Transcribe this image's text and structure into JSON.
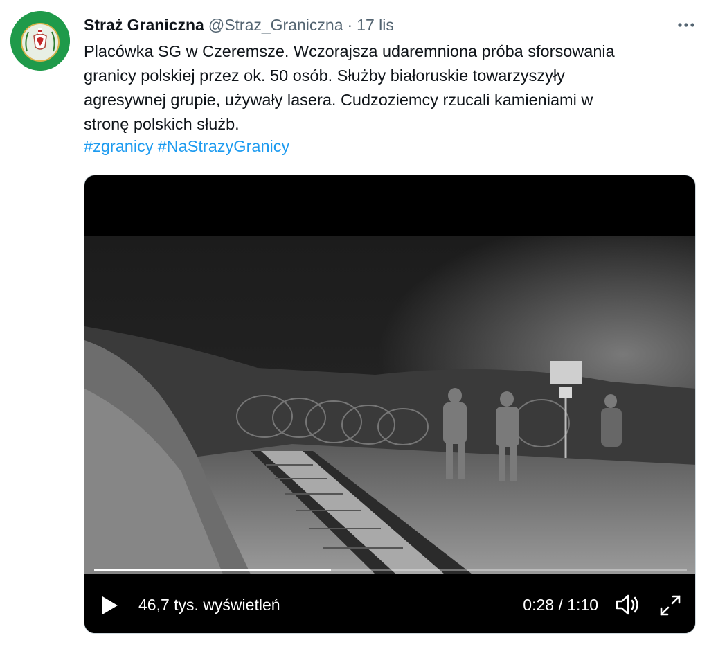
{
  "tweet": {
    "author_name": "Straż Graniczna",
    "handle": "@Straz_Graniczna",
    "separator": "·",
    "date": "17 lis",
    "text": "Placówka SG w Czeremsze. Wczorajsza udaremniona próba sforsowania\ngranicy polskiej przez ok. 50 osób. Służby białoruskie towarzyszyły\nagresywnej grupie, używały lasera. Cudzoziemcy rzucali kamieniami w\nstronę polskich służb.",
    "hashtags": [
      "#zgranicy",
      "#NaStrazyGranicy"
    ]
  },
  "video": {
    "views": "46,7 tys. wyświetleń",
    "time": "0:28 / 1:10",
    "progress_fraction": 0.4
  },
  "icons": {
    "avatar": "border-guard-emblem",
    "more": "more-dots-icon",
    "play": "play-icon",
    "volume": "volume-icon",
    "fullscreen": "fullscreen-icon"
  },
  "colors": {
    "link": "#1d9bf0",
    "avatar_bg": "#1f9a4a",
    "muted_text": "#536471"
  }
}
